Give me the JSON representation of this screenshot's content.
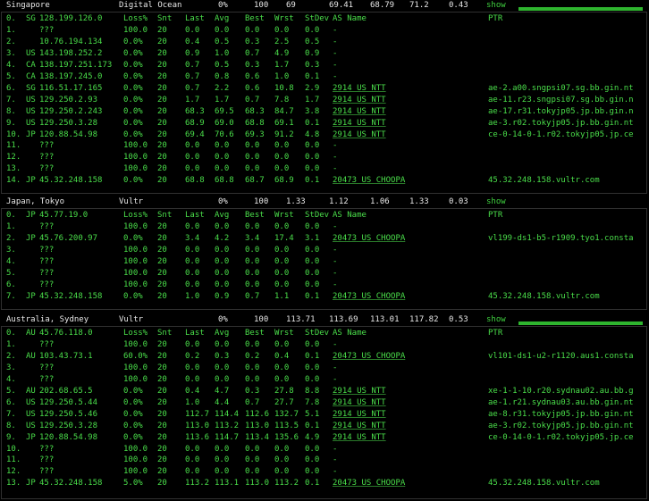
{
  "columns": {
    "loss": "Loss%",
    "snt": "Snt",
    "last": "Last",
    "avg": "Avg",
    "best": "Best",
    "wrst": "Wrst",
    "stdev": "StDev",
    "asname": "AS Name",
    "ptr": "PTR"
  },
  "sections": [
    {
      "location": "Singapore",
      "provider": "Digital Ocean",
      "summary": {
        "loss": "0%",
        "snt": "100",
        "a": "69",
        "b": "69.41",
        "c": "68.79",
        "d": "71.2",
        "e": "0.43"
      },
      "show": "show",
      "bar_fill": 1.0,
      "rows": [
        {
          "n": "0.",
          "cc": "SG",
          "ip": "128.199.126.0",
          "loss": "Loss%",
          "snt": "Snt",
          "last": "Last",
          "avg": "Avg",
          "best": "Best",
          "wrst": "Wrst",
          "stdev": "StDev",
          "as": "AS Name",
          "ptr": "PTR",
          "header": true
        },
        {
          "n": "1.",
          "cc": "",
          "ip": "???",
          "loss": "100.0",
          "snt": "20",
          "last": "0.0",
          "avg": "0.0",
          "best": "0.0",
          "wrst": "0.0",
          "stdev": "0.0",
          "as": "-",
          "ptr": ""
        },
        {
          "n": "2.",
          "cc": "",
          "ip": "10.76.194.134",
          "loss": "0.0%",
          "snt": "20",
          "last": "0.4",
          "avg": "0.5",
          "best": "0.3",
          "wrst": "2.5",
          "stdev": "0.5",
          "as": "-",
          "ptr": ""
        },
        {
          "n": "3.",
          "cc": "US",
          "ip": "143.198.252.2",
          "loss": "0.0%",
          "snt": "20",
          "last": "0.9",
          "avg": "1.0",
          "best": "0.7",
          "wrst": "4.9",
          "stdev": "0.9",
          "as": "-",
          "ptr": ""
        },
        {
          "n": "4.",
          "cc": "CA",
          "ip": "138.197.251.173",
          "loss": "0.0%",
          "snt": "20",
          "last": "0.7",
          "avg": "0.5",
          "best": "0.3",
          "wrst": "1.7",
          "stdev": "0.3",
          "as": "-",
          "ptr": ""
        },
        {
          "n": "5.",
          "cc": "CA",
          "ip": "138.197.245.0",
          "loss": "0.0%",
          "snt": "20",
          "last": "0.7",
          "avg": "0.8",
          "best": "0.6",
          "wrst": "1.0",
          "stdev": "0.1",
          "as": "-",
          "ptr": ""
        },
        {
          "n": "6.",
          "cc": "SG",
          "ip": "116.51.17.165",
          "loss": "0.0%",
          "snt": "20",
          "last": "0.7",
          "avg": "2.2",
          "best": "0.6",
          "wrst": "10.8",
          "stdev": "2.9",
          "as": "2914  US NTT",
          "ptr": "ae-2.a00.sngpsi07.sg.bb.gin.nt"
        },
        {
          "n": "7.",
          "cc": "US",
          "ip": "129.250.2.93",
          "loss": "0.0%",
          "snt": "20",
          "last": "1.7",
          "avg": "1.7",
          "best": "0.7",
          "wrst": "7.8",
          "stdev": "1.7",
          "as": "2914  US NTT",
          "ptr": "ae-11.r23.sngpsi07.sg.bb.gin.n"
        },
        {
          "n": "8.",
          "cc": "US",
          "ip": "129.250.2.243",
          "loss": "0.0%",
          "snt": "20",
          "last": "68.3",
          "avg": "69.5",
          "best": "68.3",
          "wrst": "84.7",
          "stdev": "3.8",
          "as": "2914  US NTT",
          "ptr": "ae-17.r31.tokyjp05.jp.bb.gin.n"
        },
        {
          "n": "9.",
          "cc": "US",
          "ip": "129.250.3.28",
          "loss": "0.0%",
          "snt": "20",
          "last": "68.9",
          "avg": "69.0",
          "best": "68.8",
          "wrst": "69.1",
          "stdev": "0.1",
          "as": "2914  US NTT",
          "ptr": "ae-3.r02.tokyjp05.jp.bb.gin.nt"
        },
        {
          "n": "10.",
          "cc": "JP",
          "ip": "120.88.54.98",
          "loss": "0.0%",
          "snt": "20",
          "last": "69.4",
          "avg": "70.6",
          "best": "69.3",
          "wrst": "91.2",
          "stdev": "4.8",
          "as": "2914  US NTT",
          "ptr": "ce-0-14-0-1.r02.tokyjp05.jp.ce"
        },
        {
          "n": "11.",
          "cc": "",
          "ip": "???",
          "loss": "100.0",
          "snt": "20",
          "last": "0.0",
          "avg": "0.0",
          "best": "0.0",
          "wrst": "0.0",
          "stdev": "0.0",
          "as": "-",
          "ptr": ""
        },
        {
          "n": "12.",
          "cc": "",
          "ip": "???",
          "loss": "100.0",
          "snt": "20",
          "last": "0.0",
          "avg": "0.0",
          "best": "0.0",
          "wrst": "0.0",
          "stdev": "0.0",
          "as": "-",
          "ptr": ""
        },
        {
          "n": "13.",
          "cc": "",
          "ip": "???",
          "loss": "100.0",
          "snt": "20",
          "last": "0.0",
          "avg": "0.0",
          "best": "0.0",
          "wrst": "0.0",
          "stdev": "0.0",
          "as": "-",
          "ptr": ""
        },
        {
          "n": "14.",
          "cc": "JP",
          "ip": "45.32.248.158",
          "loss": "0.0%",
          "snt": "20",
          "last": "68.8",
          "avg": "68.8",
          "best": "68.7",
          "wrst": "68.9",
          "stdev": "0.1",
          "as": "20473 US CHOOPA",
          "ptr": "45.32.248.158.vultr.com"
        }
      ]
    },
    {
      "location": "Japan, Tokyo",
      "provider": "Vultr",
      "summary": {
        "loss": "0%",
        "snt": "100",
        "a": "1.33",
        "b": "1.12",
        "c": "1.06",
        "d": "1.33",
        "e": "0.03"
      },
      "show": "show",
      "bar_fill": 0,
      "rows": [
        {
          "n": "0.",
          "cc": "JP",
          "ip": "45.77.19.0",
          "loss": "Loss%",
          "snt": "Snt",
          "last": "Last",
          "avg": "Avg",
          "best": "Best",
          "wrst": "Wrst",
          "stdev": "StDev",
          "as": "AS Name",
          "ptr": "PTR",
          "header": true
        },
        {
          "n": "1.",
          "cc": "",
          "ip": "???",
          "loss": "100.0",
          "snt": "20",
          "last": "0.0",
          "avg": "0.0",
          "best": "0.0",
          "wrst": "0.0",
          "stdev": "0.0",
          "as": "-",
          "ptr": ""
        },
        {
          "n": "2.",
          "cc": "JP",
          "ip": "45.76.200.97",
          "loss": "0.0%",
          "snt": "20",
          "last": "3.4",
          "avg": "4.2",
          "best": "3.4",
          "wrst": "17.4",
          "stdev": "3.1",
          "as": "20473 US CHOOPA",
          "ptr": "vl199-ds1-b5-r1909.tyo1.consta"
        },
        {
          "n": "3.",
          "cc": "",
          "ip": "???",
          "loss": "100.0",
          "snt": "20",
          "last": "0.0",
          "avg": "0.0",
          "best": "0.0",
          "wrst": "0.0",
          "stdev": "0.0",
          "as": "-",
          "ptr": ""
        },
        {
          "n": "4.",
          "cc": "",
          "ip": "???",
          "loss": "100.0",
          "snt": "20",
          "last": "0.0",
          "avg": "0.0",
          "best": "0.0",
          "wrst": "0.0",
          "stdev": "0.0",
          "as": "-",
          "ptr": ""
        },
        {
          "n": "5.",
          "cc": "",
          "ip": "???",
          "loss": "100.0",
          "snt": "20",
          "last": "0.0",
          "avg": "0.0",
          "best": "0.0",
          "wrst": "0.0",
          "stdev": "0.0",
          "as": "-",
          "ptr": ""
        },
        {
          "n": "6.",
          "cc": "",
          "ip": "???",
          "loss": "100.0",
          "snt": "20",
          "last": "0.0",
          "avg": "0.0",
          "best": "0.0",
          "wrst": "0.0",
          "stdev": "0.0",
          "as": "-",
          "ptr": ""
        },
        {
          "n": "7.",
          "cc": "JP",
          "ip": "45.32.248.158",
          "loss": "0.0%",
          "snt": "20",
          "last": "1.0",
          "avg": "0.9",
          "best": "0.7",
          "wrst": "1.1",
          "stdev": "0.1",
          "as": "20473 US CHOOPA",
          "ptr": "45.32.248.158.vultr.com"
        }
      ]
    },
    {
      "location": "Australia, Sydney",
      "provider": "Vultr",
      "summary": {
        "loss": "0%",
        "snt": "100",
        "a": "113.71",
        "b": "113.69",
        "c": "113.01",
        "d": "117.82",
        "e": "0.53"
      },
      "show": "show",
      "bar_fill": 1.0,
      "rows": [
        {
          "n": "0.",
          "cc": "AU",
          "ip": "45.76.118.0",
          "loss": "Loss%",
          "snt": "Snt",
          "last": "Last",
          "avg": "Avg",
          "best": "Best",
          "wrst": "Wrst",
          "stdev": "StDev",
          "as": "AS Name",
          "ptr": "PTR",
          "header": true
        },
        {
          "n": "1.",
          "cc": "",
          "ip": "???",
          "loss": "100.0",
          "snt": "20",
          "last": "0.0",
          "avg": "0.0",
          "best": "0.0",
          "wrst": "0.0",
          "stdev": "0.0",
          "as": "-",
          "ptr": ""
        },
        {
          "n": "2.",
          "cc": "AU",
          "ip": "103.43.73.1",
          "loss": "60.0%",
          "snt": "20",
          "last": "0.2",
          "avg": "0.3",
          "best": "0.2",
          "wrst": "0.4",
          "stdev": "0.1",
          "as": "20473 US CHOOPA",
          "ptr": "vl101-ds1-u2-r1120.aus1.consta"
        },
        {
          "n": "3.",
          "cc": "",
          "ip": "???",
          "loss": "100.0",
          "snt": "20",
          "last": "0.0",
          "avg": "0.0",
          "best": "0.0",
          "wrst": "0.0",
          "stdev": "0.0",
          "as": "-",
          "ptr": ""
        },
        {
          "n": "4.",
          "cc": "",
          "ip": "???",
          "loss": "100.0",
          "snt": "20",
          "last": "0.0",
          "avg": "0.0",
          "best": "0.0",
          "wrst": "0.0",
          "stdev": "0.0",
          "as": "-",
          "ptr": ""
        },
        {
          "n": "5.",
          "cc": "AU",
          "ip": "202.68.65.5",
          "loss": "0.0%",
          "snt": "20",
          "last": "0.4",
          "avg": "4.7",
          "best": "0.3",
          "wrst": "27.8",
          "stdev": "8.8",
          "as": "2914  US NTT",
          "ptr": "xe-1-1-10.r20.sydnau02.au.bb.g"
        },
        {
          "n": "6.",
          "cc": "US",
          "ip": "129.250.5.44",
          "loss": "0.0%",
          "snt": "20",
          "last": "1.0",
          "avg": "4.4",
          "best": "0.7",
          "wrst": "27.7",
          "stdev": "7.8",
          "as": "2914  US NTT",
          "ptr": "ae-1.r21.sydnau03.au.bb.gin.nt"
        },
        {
          "n": "7.",
          "cc": "US",
          "ip": "129.250.5.46",
          "loss": "0.0%",
          "snt": "20",
          "last": "112.7",
          "avg": "114.4",
          "best": "112.6",
          "wrst": "132.7",
          "stdev": "5.1",
          "as": "2914  US NTT",
          "ptr": "ae-8.r31.tokyjp05.jp.bb.gin.nt"
        },
        {
          "n": "8.",
          "cc": "US",
          "ip": "129.250.3.28",
          "loss": "0.0%",
          "snt": "20",
          "last": "113.0",
          "avg": "113.2",
          "best": "113.0",
          "wrst": "113.5",
          "stdev": "0.1",
          "as": "2914  US NTT",
          "ptr": "ae-3.r02.tokyjp05.jp.bb.gin.nt"
        },
        {
          "n": "9.",
          "cc": "JP",
          "ip": "120.88.54.98",
          "loss": "0.0%",
          "snt": "20",
          "last": "113.6",
          "avg": "114.7",
          "best": "113.4",
          "wrst": "135.6",
          "stdev": "4.9",
          "as": "2914  US NTT",
          "ptr": "ce-0-14-0-1.r02.tokyjp05.jp.ce"
        },
        {
          "n": "10.",
          "cc": "",
          "ip": "???",
          "loss": "100.0",
          "snt": "20",
          "last": "0.0",
          "avg": "0.0",
          "best": "0.0",
          "wrst": "0.0",
          "stdev": "0.0",
          "as": "-",
          "ptr": ""
        },
        {
          "n": "11.",
          "cc": "",
          "ip": "???",
          "loss": "100.0",
          "snt": "20",
          "last": "0.0",
          "avg": "0.0",
          "best": "0.0",
          "wrst": "0.0",
          "stdev": "0.0",
          "as": "-",
          "ptr": ""
        },
        {
          "n": "12.",
          "cc": "",
          "ip": "???",
          "loss": "100.0",
          "snt": "20",
          "last": "0.0",
          "avg": "0.0",
          "best": "0.0",
          "wrst": "0.0",
          "stdev": "0.0",
          "as": "-",
          "ptr": ""
        },
        {
          "n": "13.",
          "cc": "JP",
          "ip": "45.32.248.158",
          "loss": "5.0%",
          "snt": "20",
          "last": "113.2",
          "avg": "113.1",
          "best": "113.0",
          "wrst": "113.2",
          "stdev": "0.1",
          "as": "20473 US CHOOPA",
          "ptr": "45.32.248.158.vultr.com"
        }
      ]
    }
  ]
}
